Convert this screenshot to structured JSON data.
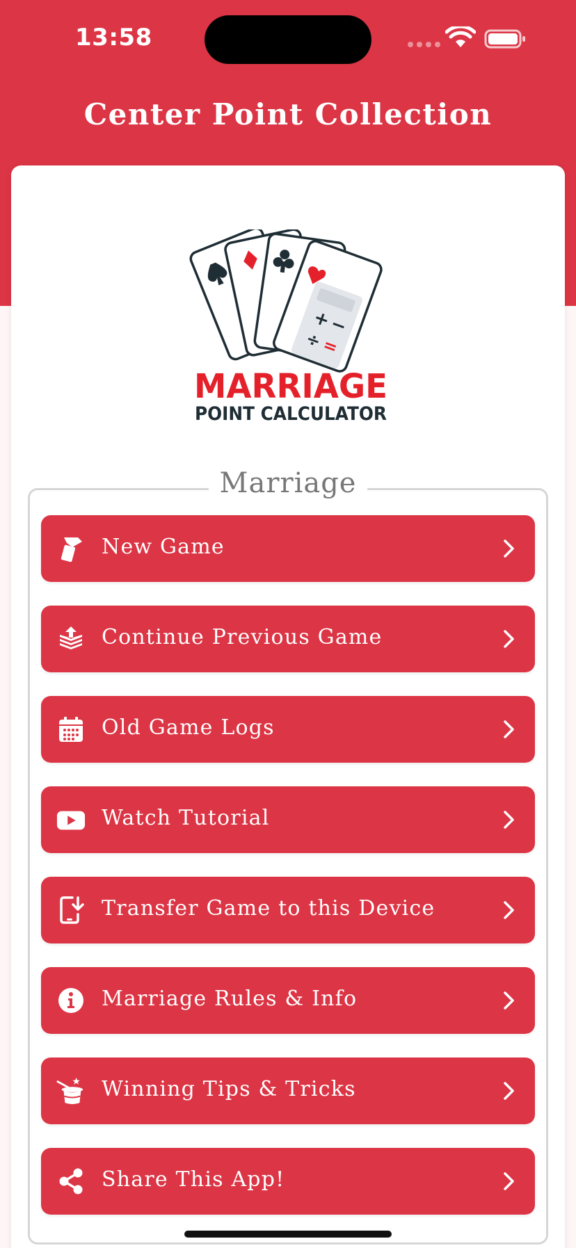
{
  "status_bar": {
    "time": "13:58",
    "wifi_icon": "wifi-icon",
    "battery_icon": "battery-icon"
  },
  "header": {
    "title": "Center Point Collection"
  },
  "logo": {
    "line1": "MARRIAGE",
    "line2": "POINT CALCULATOR",
    "icon": "playing-cards-calculator-logo"
  },
  "group": {
    "legend": "Marriage"
  },
  "menu": {
    "items": [
      {
        "label": "New Game",
        "icon": "card-hand-icon"
      },
      {
        "label": "Continue Previous Game",
        "icon": "stack-upload-icon"
      },
      {
        "label": "Old Game Logs",
        "icon": "calendar-icon"
      },
      {
        "label": "Watch Tutorial",
        "icon": "youtube-play-icon"
      },
      {
        "label": "Transfer Game to this Device",
        "icon": "phone-download-icon"
      },
      {
        "label": "Marriage Rules & Info",
        "icon": "info-icon"
      },
      {
        "label": "Winning Tips & Tricks",
        "icon": "magic-hat-icon"
      },
      {
        "label": "Share This App!",
        "icon": "share-icon"
      }
    ]
  },
  "colors": {
    "brand_red": "#dc3545",
    "logo_red": "#e4212b",
    "logo_dark": "#1f2d35",
    "legend_gray": "#777777"
  }
}
